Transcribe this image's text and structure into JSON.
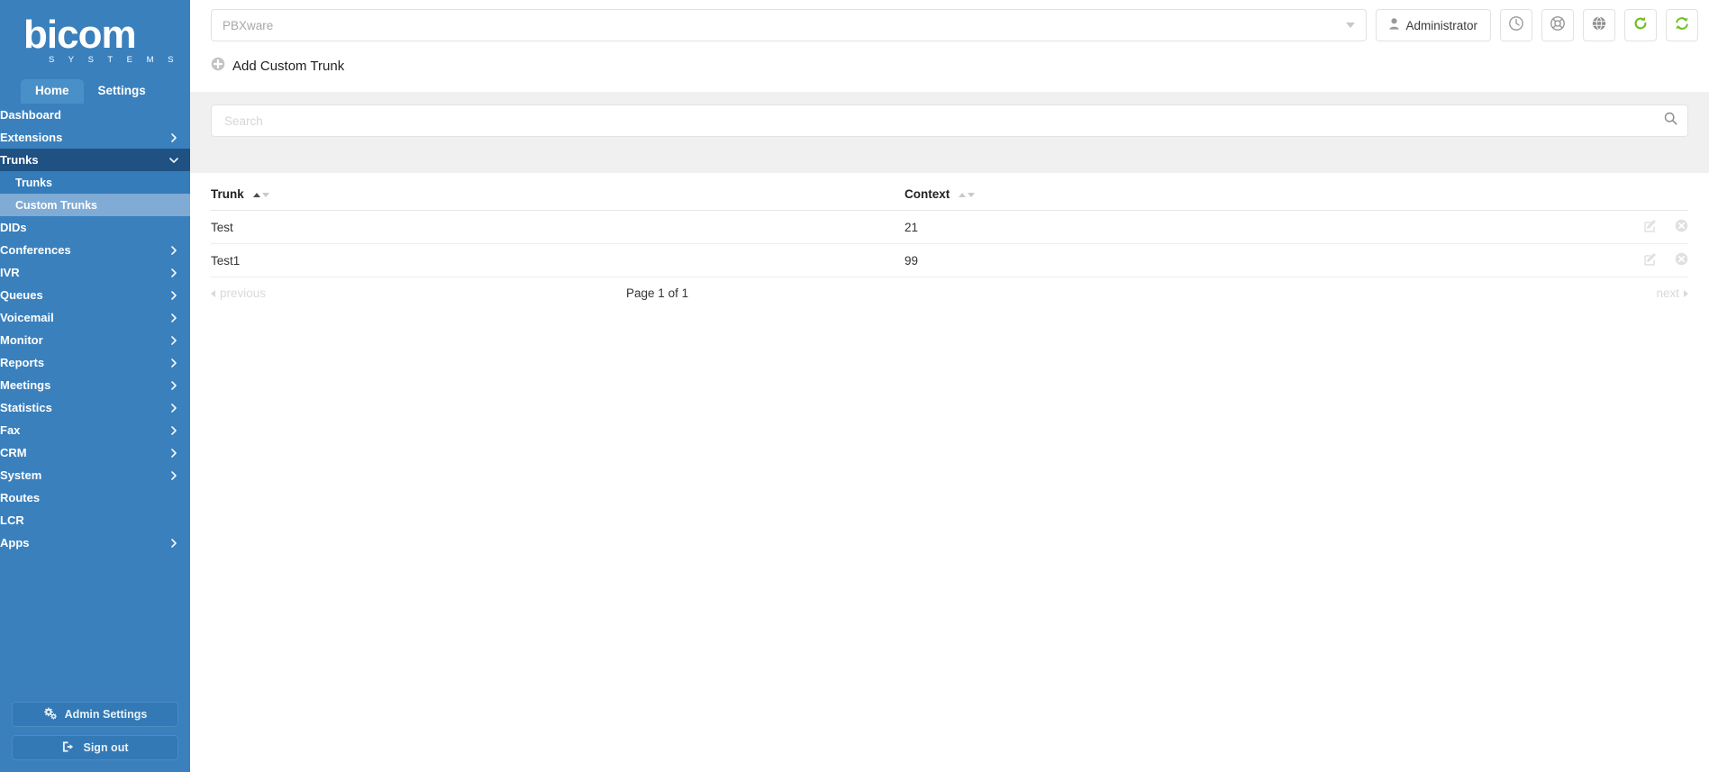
{
  "brand": {
    "logo_text": "bicom",
    "logo_subtext": "S Y S T E M S",
    "sidebar_bg": "#3a80bd",
    "accent_green": "#7ac943"
  },
  "sidebar": {
    "tabs": [
      {
        "label": "Home",
        "active": true
      },
      {
        "label": "Settings",
        "active": false
      }
    ],
    "items": [
      {
        "label": "Dashboard",
        "has_chevron": false,
        "state": "normal"
      },
      {
        "label": "Extensions",
        "has_chevron": true,
        "state": "normal"
      },
      {
        "label": "Trunks",
        "has_chevron": true,
        "state": "open"
      },
      {
        "label": "Trunks",
        "has_chevron": false,
        "state": "sub"
      },
      {
        "label": "Custom Trunks",
        "has_chevron": false,
        "state": "sub-active"
      },
      {
        "label": "DIDs",
        "has_chevron": false,
        "state": "normal"
      },
      {
        "label": "Conferences",
        "has_chevron": true,
        "state": "normal"
      },
      {
        "label": "IVR",
        "has_chevron": true,
        "state": "normal"
      },
      {
        "label": "Queues",
        "has_chevron": true,
        "state": "normal"
      },
      {
        "label": "Voicemail",
        "has_chevron": true,
        "state": "normal"
      },
      {
        "label": "Monitor",
        "has_chevron": true,
        "state": "normal"
      },
      {
        "label": "Reports",
        "has_chevron": true,
        "state": "normal"
      },
      {
        "label": "Meetings",
        "has_chevron": true,
        "state": "normal"
      },
      {
        "label": "Statistics",
        "has_chevron": true,
        "state": "normal"
      },
      {
        "label": "Fax",
        "has_chevron": true,
        "state": "normal"
      },
      {
        "label": "CRM",
        "has_chevron": true,
        "state": "normal"
      },
      {
        "label": "System",
        "has_chevron": true,
        "state": "normal"
      },
      {
        "label": "Routes",
        "has_chevron": false,
        "state": "normal"
      },
      {
        "label": "LCR",
        "has_chevron": false,
        "state": "normal"
      },
      {
        "label": "Apps",
        "has_chevron": true,
        "state": "normal"
      }
    ],
    "admin_settings_label": "Admin Settings",
    "admin_settings_icon": "gears-icon",
    "sign_out_label": "Sign out",
    "sign_out_icon": "sign-out-icon"
  },
  "topbar": {
    "server_select_value": "PBXware",
    "user_label": "Administrator",
    "user_icon": "user-icon",
    "icons": [
      {
        "name": "clock-icon",
        "color": "#9a9a9a"
      },
      {
        "name": "life-ring-icon",
        "color": "#9a9a9a"
      },
      {
        "name": "globe-icon",
        "color": "#8f8f8f"
      },
      {
        "name": "refresh-icon",
        "color": "#6fbf1f"
      },
      {
        "name": "sync-icon",
        "color": "#6fbf1f"
      }
    ]
  },
  "page": {
    "title": "Add Custom Trunk",
    "title_icon": "circle-plus-icon"
  },
  "search": {
    "placeholder": "Search",
    "value": "",
    "icon": "search-icon"
  },
  "table": {
    "columns": [
      {
        "label": "Trunk",
        "sort": "asc"
      },
      {
        "label": "Context",
        "sort": "none"
      }
    ],
    "rows": [
      {
        "trunk": "Test",
        "context": "21",
        "edit_icon": "edit-icon",
        "delete_icon": "delete-icon"
      },
      {
        "trunk": "Test1",
        "context": "99",
        "edit_icon": "edit-icon",
        "delete_icon": "delete-icon"
      }
    ]
  },
  "pagination": {
    "previous_label": "previous",
    "page_label": "Page 1 of 1",
    "next_label": "next"
  }
}
